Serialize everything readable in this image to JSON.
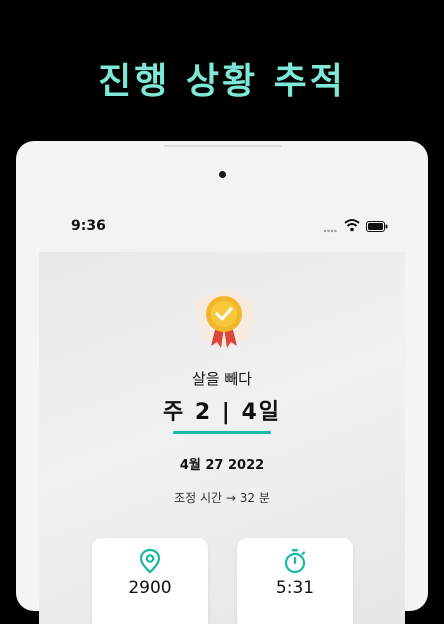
{
  "headline": "진행 상황 추적",
  "status_bar": {
    "time": "9:36"
  },
  "goal": {
    "title": "살을 빼다",
    "week_day": "주 2 | 4일",
    "date": "4월 27 2022",
    "adjustment": "조정 시간 → 32 분"
  },
  "stats": [
    {
      "icon": "location-pin-icon",
      "value": "2900"
    },
    {
      "icon": "stopwatch-icon",
      "value": "5:31"
    }
  ],
  "colors": {
    "accent": "#18b9a3",
    "headline": "#7ee8d7",
    "background": "#000000"
  }
}
